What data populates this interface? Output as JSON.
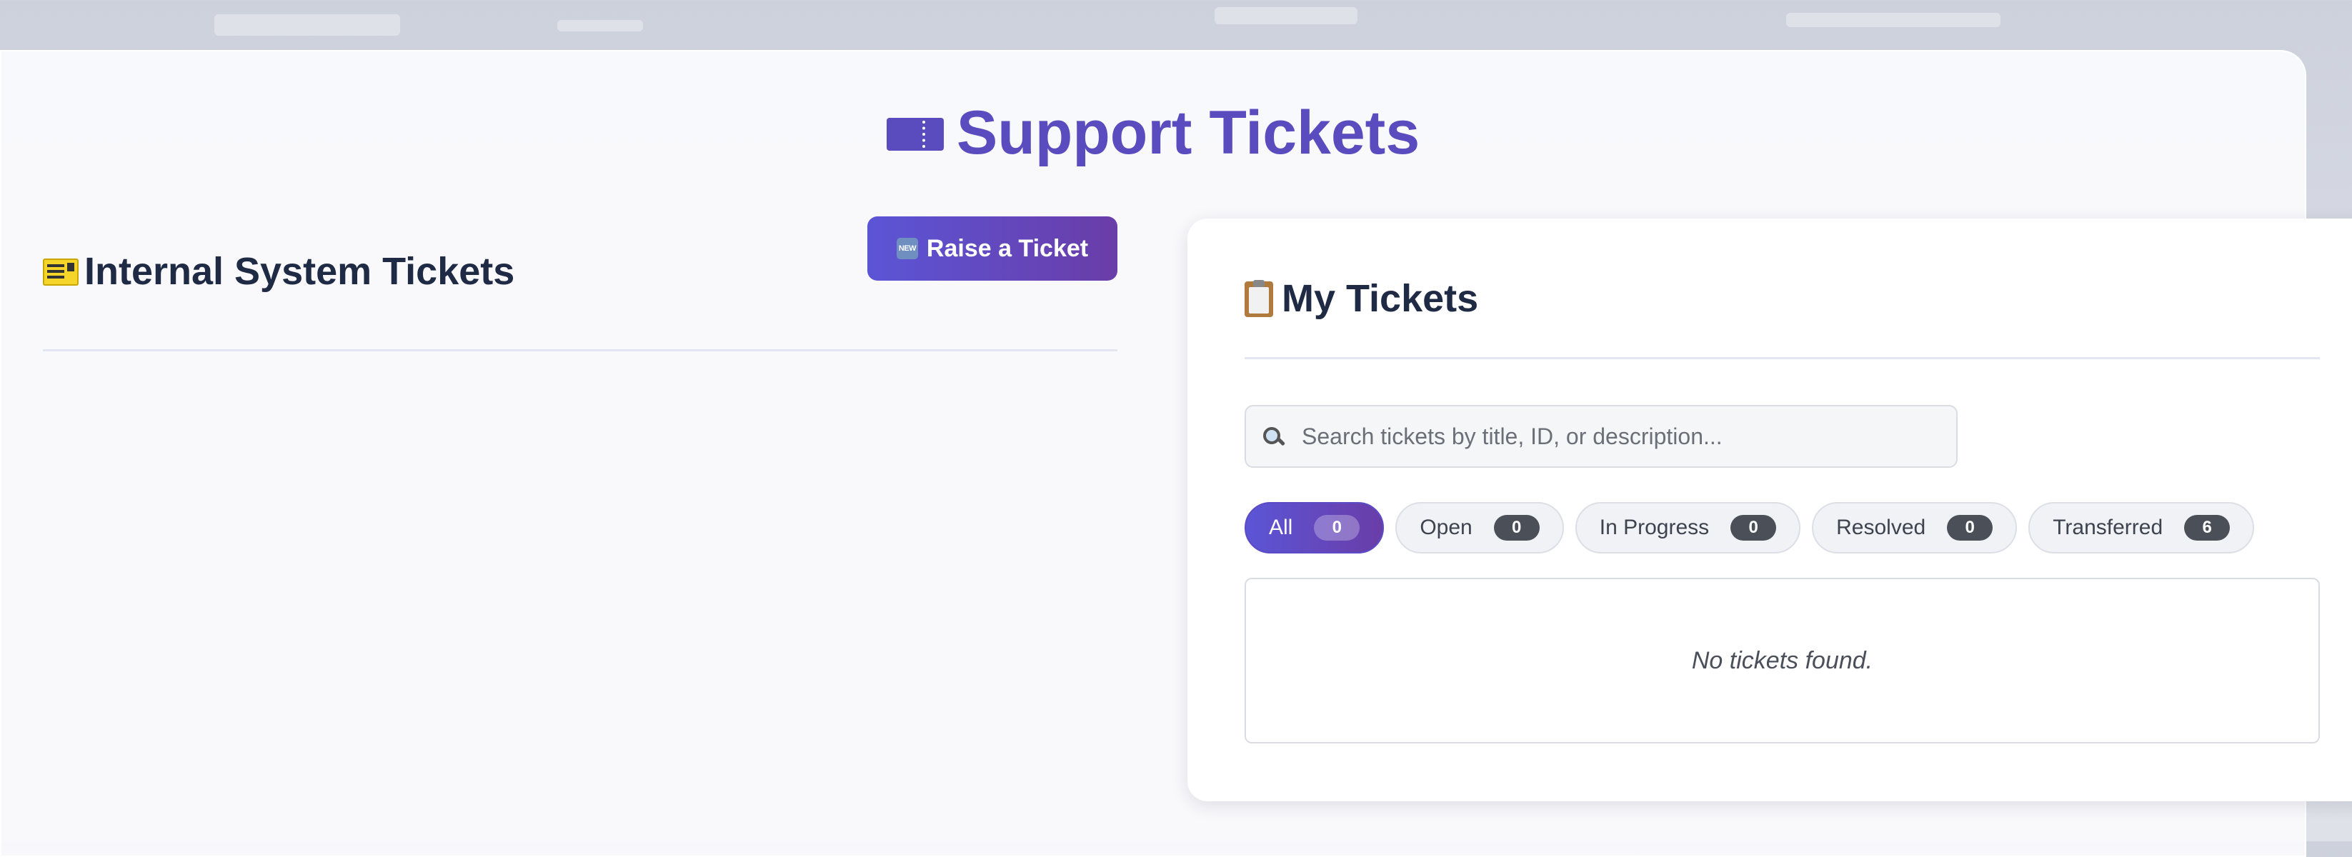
{
  "header": {
    "title": "Support Tickets",
    "title_icon": "ticket-icon",
    "accent_color": "#5a4bbf"
  },
  "internal": {
    "title": "Internal System Tickets",
    "title_icon": "service-ticket-icon",
    "raise_button": {
      "label": "Raise a Ticket",
      "icon": "new-badge-icon",
      "icon_text": "NEW"
    }
  },
  "my_tickets": {
    "title": "My Tickets",
    "title_icon": "clipboard-icon",
    "search": {
      "placeholder": "Search tickets by title, ID, or description...",
      "value": ""
    },
    "filters": [
      {
        "label": "All",
        "count": "0",
        "active": true
      },
      {
        "label": "Open",
        "count": "0",
        "active": false
      },
      {
        "label": "In Progress",
        "count": "0",
        "active": false
      },
      {
        "label": "Resolved",
        "count": "0",
        "active": false
      },
      {
        "label": "Transferred",
        "count": "6",
        "active": false
      }
    ],
    "empty_message": "No tickets found."
  }
}
